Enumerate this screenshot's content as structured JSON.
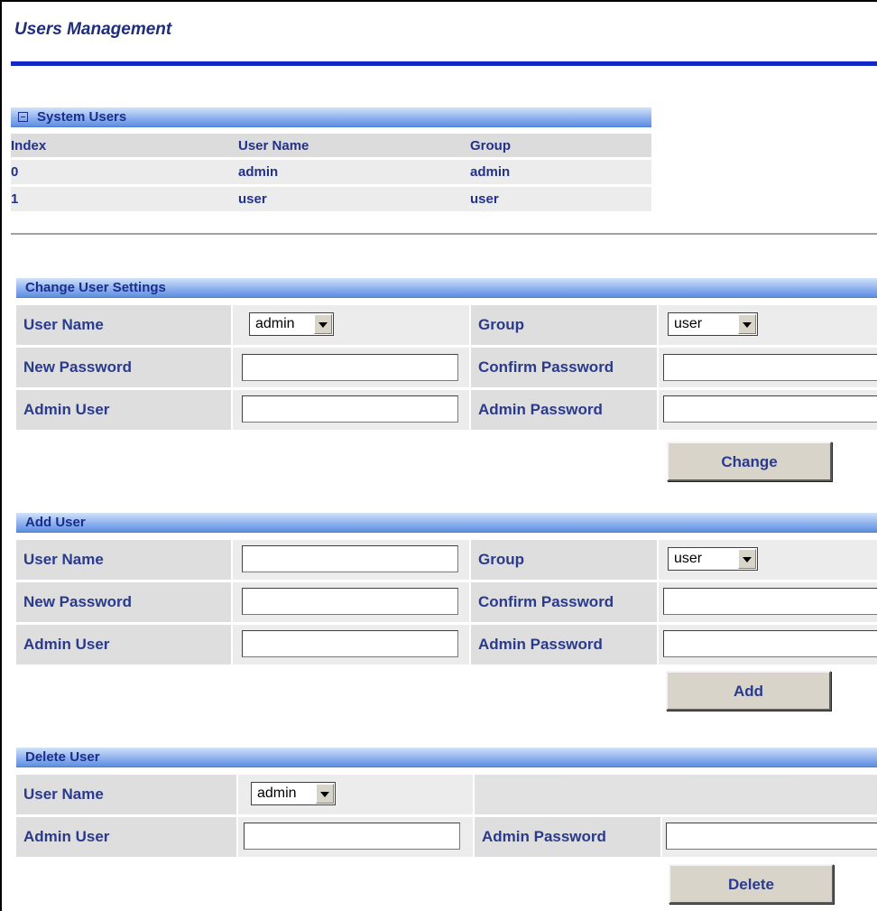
{
  "page": {
    "title": "Users Management"
  },
  "system_users": {
    "header": "System Users",
    "columns": [
      "Index",
      "User Name",
      "Group"
    ],
    "rows": [
      {
        "index": "0",
        "user_name": "admin",
        "group": "admin"
      },
      {
        "index": "1",
        "user_name": "user",
        "group": "user"
      }
    ]
  },
  "change_user": {
    "header": "Change User Settings",
    "user_name_label": "User Name",
    "user_name_value": "admin",
    "group_label": "Group",
    "group_value": "user",
    "new_password_label": "New Password",
    "new_password_value": "",
    "confirm_password_label": "Confirm Password",
    "confirm_password_value": "",
    "admin_user_label": "Admin User",
    "admin_user_value": "",
    "admin_password_label": "Admin Password",
    "admin_password_value": "",
    "button_label": "Change"
  },
  "add_user": {
    "header": "Add User",
    "user_name_label": "User Name",
    "user_name_value": "",
    "group_label": "Group",
    "group_value": "user",
    "new_password_label": "New Password",
    "new_password_value": "",
    "confirm_password_label": "Confirm Password",
    "confirm_password_value": "",
    "admin_user_label": "Admin User",
    "admin_user_value": "",
    "admin_password_label": "Admin Password",
    "admin_password_value": "",
    "button_label": "Add"
  },
  "delete_user": {
    "header": "Delete User",
    "user_name_label": "User Name",
    "user_name_value": "admin",
    "admin_user_label": "Admin User",
    "admin_user_value": "",
    "admin_password_label": "Admin Password",
    "admin_password_value": "",
    "button_label": "Delete"
  },
  "colors": {
    "title_text": "#1f2e7a",
    "title_rule": "#1428c8",
    "section_header_start": "#d2e2fa",
    "section_header_end": "#5e8ee0",
    "label_text": "#2a3a8c",
    "cell_bg": "#dedede"
  },
  "icons": {
    "system_users_toggle": "collapse-minus-icon",
    "select_arrow": "chevron-down-icon"
  }
}
